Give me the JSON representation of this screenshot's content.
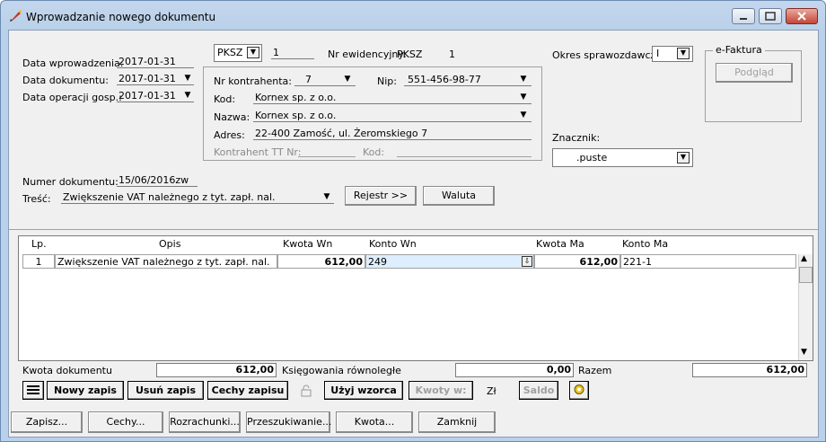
{
  "window": {
    "title": "Wprowadzanie nowego dokumentu"
  },
  "dates": {
    "entry_label": "Data wprowadzenia:",
    "entry_value": "2017-01-31",
    "document_label": "Data dokumentu:",
    "document_value": "2017-01-31",
    "operation_label": "Data operacji gosp.:",
    "operation_value": "2017-01-31"
  },
  "doc_type": {
    "value": "PKSZ",
    "number": "1",
    "register_label": "Nr ewidencyjny:",
    "register_code": "PKSZ",
    "register_number": "1"
  },
  "contractor": {
    "nr_label": "Nr kontrahenta:",
    "nr_value": "7",
    "nip_label": "Nip:",
    "nip_value": "551-456-98-77",
    "kod_label": "Kod:",
    "kod_value": "Kornex sp. z o.o.",
    "nazwa_label": "Nazwa:",
    "nazwa_value": "Kornex sp. z o.o.",
    "adres_label": "Adres:",
    "adres_value": "22-400 Zamość, ul. Żeromskiego 7",
    "tt_label": "Kontrahent TT Nr:",
    "tt_kod_label": "Kod:"
  },
  "period": {
    "label": "Okres sprawozdawczy:",
    "value": "I"
  },
  "efaktura": {
    "label": "e-Faktura",
    "preview_button": "Podgląd"
  },
  "marker": {
    "label": "Znacznik:",
    "value": ".puste"
  },
  "document": {
    "number_label": "Numer dokumentu:",
    "number_value": "15/06/2016zw",
    "content_label": "Treść:",
    "content_value": "Zwiększenie VAT należnego z tyt. zapł. nal.",
    "register_button": "Rejestr >>",
    "currency_button": "Waluta"
  },
  "grid": {
    "headers": {
      "lp": "Lp.",
      "opis": "Opis",
      "kwota_wn": "Kwota  Wn",
      "konto_wn": "Konto  Wn",
      "kwota_ma": "Kwota Ma",
      "konto_ma": "Konto Ma"
    },
    "rows": [
      {
        "lp": "1",
        "opis": "Zwiększenie VAT należnego z tyt. zapł. nal.",
        "kwota_wn": "612,00",
        "konto_wn": "249",
        "kwota_ma": "612,00",
        "konto_ma": "221-1"
      }
    ]
  },
  "summary": {
    "doc_amount_label": "Kwota dokumentu",
    "doc_amount_value": "612,00",
    "parallel_label": "Księgowania równoległe",
    "parallel_value": "0,00",
    "total_label": "Razem",
    "total_value": "612,00"
  },
  "entry_toolbar": {
    "new_entry": "Nowy zapis",
    "delete_entry": "Usuń zapis",
    "entry_features": "Cechy zapisu",
    "use_template": "Użyj wzorca",
    "amounts": "Kwoty w:",
    "currency_code": "Zł",
    "balance": "Saldo"
  },
  "bottom_buttons": {
    "save": "Zapisz...",
    "features": "Cechy...",
    "settlements": "Rozrachunki...",
    "search": "Przeszukiwanie...",
    "amount": "Kwota...",
    "close": "Zamknij"
  },
  "colors": {
    "titlebar": "#b9d1ea",
    "client": "#f0f0f0",
    "selected_cell": "#ddeeff"
  }
}
